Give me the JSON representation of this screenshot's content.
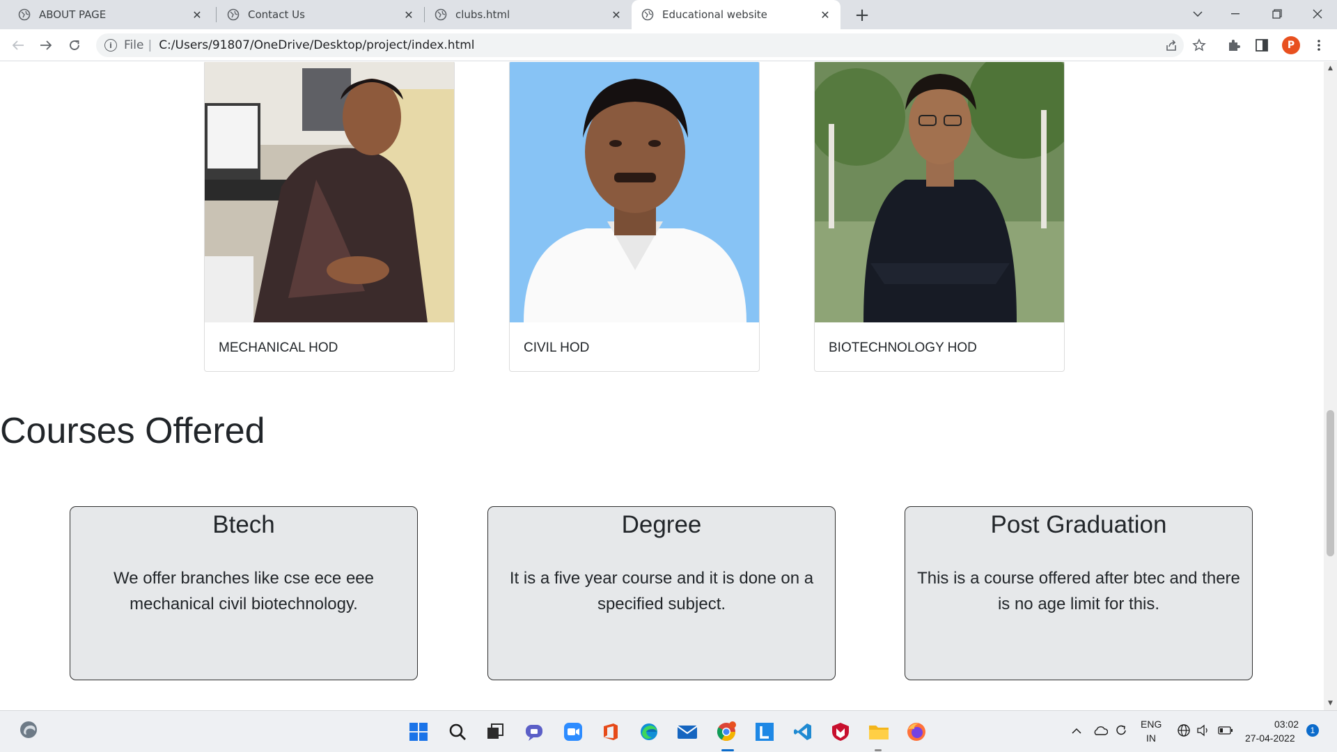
{
  "browser": {
    "tabs": [
      {
        "title": "ABOUT PAGE",
        "active": false
      },
      {
        "title": "Contact Us",
        "active": false
      },
      {
        "title": "clubs.html",
        "active": false
      },
      {
        "title": "Educational website",
        "active": true
      }
    ],
    "address": {
      "scheme": "File",
      "url": "C:/Users/91807/OneDrive/Desktop/project/index.html"
    },
    "profile_initial": "P"
  },
  "hods": [
    {
      "label": "MECHANICAL HOD"
    },
    {
      "label": "CIVIL HOD"
    },
    {
      "label": "BIOTECHNOLOGY HOD"
    }
  ],
  "courses_section": {
    "title": "Courses Offered",
    "courses": [
      {
        "title": "Btech",
        "description": "We offer branches like cse ece eee mechanical civil biotechnology."
      },
      {
        "title": "Degree",
        "description": "It is a five year course and it is done on a specified subject."
      },
      {
        "title": "Post Graduation",
        "description": "This is a course offered after btec and there is no age limit for this."
      }
    ]
  },
  "taskbar": {
    "language": "ENG",
    "region": "IN",
    "time": "03:02",
    "date": "27-04-2022",
    "notification_count": "1"
  }
}
